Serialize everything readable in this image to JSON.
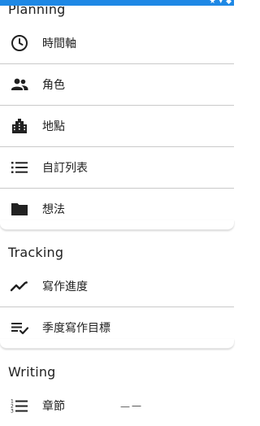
{
  "sections": [
    {
      "header": "Planning",
      "items": [
        {
          "label": "時間軸",
          "icon": "clock-icon"
        },
        {
          "label": "角色",
          "icon": "people-icon"
        },
        {
          "label": "地點",
          "icon": "city-icon"
        },
        {
          "label": "自訂列表",
          "icon": "list-icon"
        },
        {
          "label": "想法",
          "icon": "folder-icon"
        }
      ]
    },
    {
      "header": "Tracking",
      "items": [
        {
          "label": "寫作進度",
          "icon": "trend-line-icon"
        },
        {
          "label": "季度寫作目標",
          "icon": "checklist-icon"
        }
      ]
    },
    {
      "header": "Writing",
      "items": [
        {
          "label": "章節",
          "icon": "numbered-list-icon"
        }
      ]
    }
  ],
  "partial_text": "—一",
  "accent_color": "#1e88e5"
}
